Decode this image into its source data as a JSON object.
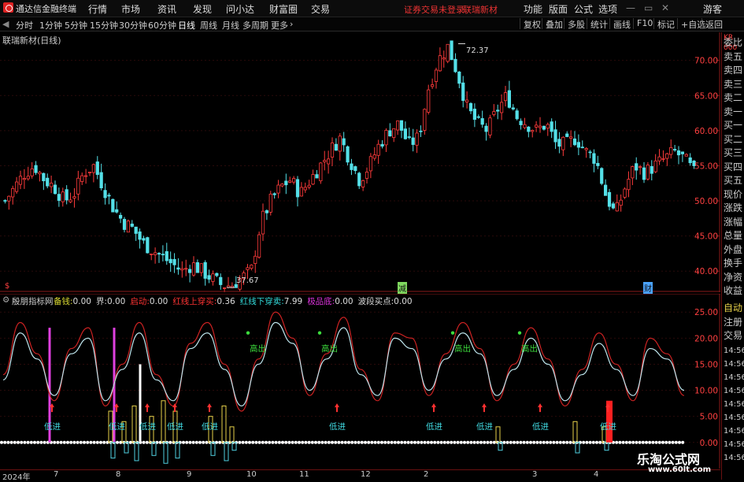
{
  "app": {
    "title": "通达信金融终端",
    "status_warning": "证券交易未登录",
    "stock_short": "联瑞新材",
    "guest": "游客"
  },
  "menu": [
    "行情",
    "市场",
    "资讯",
    "发现",
    "问小达",
    "财富圈",
    "交易"
  ],
  "menu_right": [
    "功能",
    "版面",
    "公式",
    "选项"
  ],
  "periods": {
    "items": [
      "分时",
      "1分钟",
      "5分钟",
      "15分钟",
      "30分钟",
      "60分钟",
      "日线",
      "周线",
      "月线",
      "多周期",
      "更多"
    ],
    "active": "日线"
  },
  "toolbar_right": [
    "复权",
    "叠加",
    "多股",
    "统计",
    "画线",
    "F10",
    "标记",
    "+自选",
    "返回"
  ],
  "main_chart": {
    "title": "联瑞新材(日线)",
    "y_ticks": [
      "70.00",
      "65.00",
      "60.00",
      "55.00",
      "50.00",
      "45.00",
      "40.00"
    ],
    "high_label": "72.37",
    "low_label": "37.67",
    "markers": [
      "减",
      "财"
    ]
  },
  "indicator": {
    "name": "殷朋指标网",
    "params": [
      {
        "label": "备钱:",
        "value": "0.00",
        "color": "#dddd33"
      },
      {
        "label": "界:",
        "value": "0.00",
        "color": "#dddddd"
      },
      {
        "label": "启动:",
        "value": "0.00",
        "color": "#ff3333"
      },
      {
        "label": "红线上穿买:",
        "value": "0.36",
        "color": "#ff3333"
      },
      {
        "label": "红线下穿卖:",
        "value": "7.99",
        "color": "#33dddd"
      },
      {
        "label": "极品底:",
        "value": "0.00",
        "color": "#dd33dd"
      },
      {
        "label": "波段买点:",
        "value": "0.00",
        "color": "#dddddd"
      }
    ],
    "y_ticks": [
      "25.00",
      "20.00",
      "15.00",
      "10.00",
      "5.00",
      "0.00"
    ],
    "high_label": "高出",
    "low_label": "低进"
  },
  "x_axis": [
    "2024年",
    "7",
    "8",
    "9",
    "10",
    "11",
    "12",
    "2",
    "3",
    "4"
  ],
  "right_panel": {
    "top": "KR 000",
    "items": [
      "委比",
      "卖五",
      "卖四",
      "卖三",
      "卖二",
      "卖一",
      "买一",
      "买二",
      "买三",
      "买四",
      "买五",
      "现价",
      "涨跌",
      "涨幅",
      "总量",
      "外盘",
      "换手",
      "净资",
      "收益"
    ],
    "lower": [
      "自动",
      "注册",
      "交易"
    ],
    "times": [
      "14:56",
      "14:56",
      "14:56",
      "14:56",
      "14:56",
      "14:56",
      "14:56",
      "14:56",
      "14:56"
    ]
  },
  "watermark": {
    "text": "乐淘公式网",
    "url": "www.60lt.com"
  },
  "colors": {
    "up": "#ff3b3b",
    "down": "#54e0e8",
    "axis": "#8a1a1a",
    "bg": "#000000"
  },
  "chart_data": [
    {
      "type": "candlestick",
      "title": "联瑞新材(日线)",
      "ylim": [
        37,
        74
      ],
      "x": [
        "2024年",
        "7",
        "8",
        "9",
        "10",
        "11",
        "12",
        "2",
        "3",
        "4"
      ],
      "close_path": [
        50,
        52,
        54,
        55,
        53,
        52,
        50,
        51,
        54,
        55,
        52,
        49,
        47,
        46,
        44,
        43,
        42,
        41,
        40,
        41,
        40,
        39,
        38,
        38,
        39,
        40,
        47,
        50,
        52,
        53,
        51,
        53,
        55,
        57,
        59,
        56,
        53,
        55,
        58,
        60,
        61,
        58,
        59,
        66,
        70,
        72,
        68,
        63,
        61,
        60,
        63,
        65,
        62,
        61,
        60,
        61,
        58,
        58,
        59,
        57,
        56,
        51,
        48,
        52,
        55,
        54,
        55,
        56,
        57,
        56,
        54
      ],
      "high": 72.37,
      "low": 37.67
    },
    {
      "type": "line",
      "title": "殷朋指标网",
      "ylim": [
        -2,
        27
      ],
      "series": [
        {
          "name": "白线",
          "values": [
            12,
            21,
            16,
            9,
            17,
            20,
            8,
            14,
            21,
            12,
            8,
            18,
            21,
            14,
            7,
            15,
            23,
            19,
            10,
            16,
            22,
            13,
            9,
            20,
            18,
            10,
            16,
            21,
            17,
            9,
            14,
            20,
            15,
            8,
            13,
            19,
            14,
            9,
            18,
            16,
            10
          ]
        },
        {
          "name": "红线",
          "values": [
            13,
            23,
            17,
            8,
            18,
            22,
            7,
            15,
            23,
            13,
            7,
            19,
            23,
            15,
            6,
            16,
            25,
            20,
            9,
            17,
            24,
            14,
            8,
            21,
            20,
            9,
            17,
            23,
            18,
            8,
            15,
            22,
            16,
            7,
            14,
            21,
            15,
            8,
            20,
            17,
            9
          ]
        }
      ]
    }
  ]
}
